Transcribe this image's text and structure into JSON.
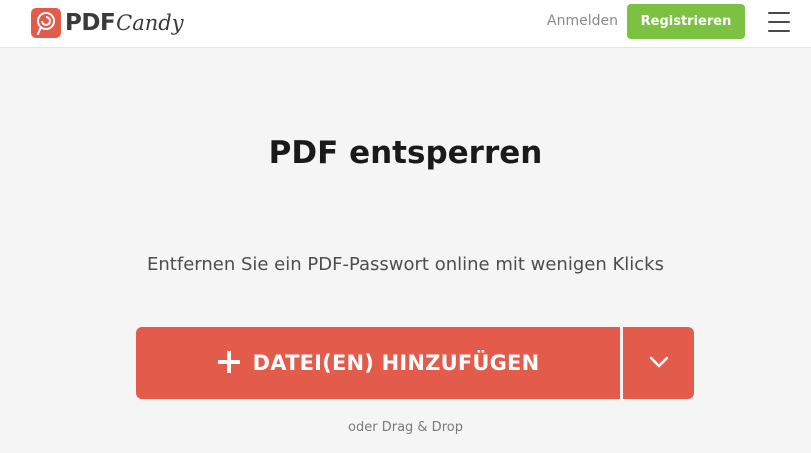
{
  "colors": {
    "brand": "#e35b4a",
    "green": "#7cc142"
  },
  "header": {
    "logo_pdf": "PDF",
    "logo_candy": "Candy",
    "login_label": "Anmelden",
    "register_label": "Registrieren",
    "menu_icon": "hamburger-menu-icon"
  },
  "main": {
    "title": "PDF entsperren",
    "subtitle": "Entfernen Sie ein PDF-Passwort online mit wenigen Klicks",
    "add_files_label": "DATEI(EN) HINZUFÜGEN",
    "add_icon": "plus-icon",
    "dropdown_icon": "chevron-down-icon",
    "drag_drop_hint": "oder Drag & Drop"
  }
}
